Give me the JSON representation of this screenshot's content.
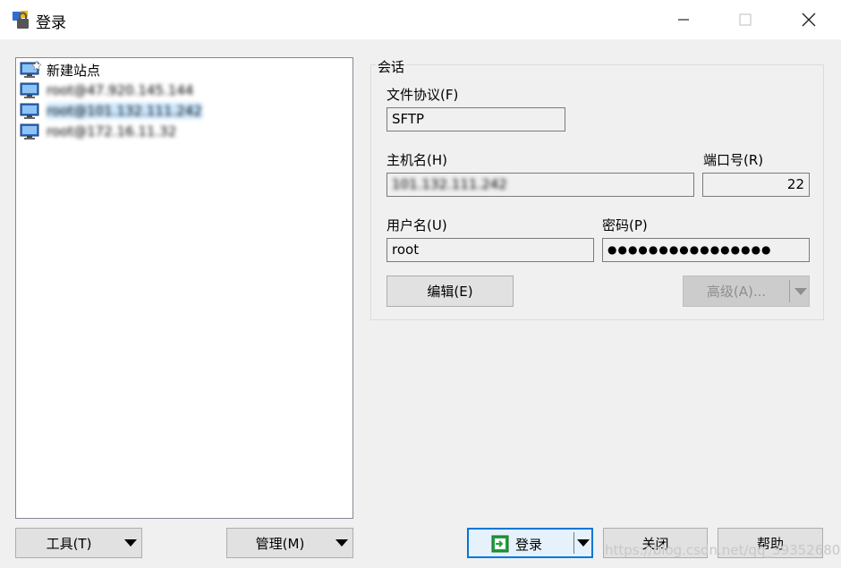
{
  "window": {
    "title": "登录"
  },
  "sites": {
    "items": [
      {
        "label": "新建站点",
        "icon": "new-site-icon"
      },
      {
        "label": "root@47.920.145.144",
        "icon": "monitor-icon"
      },
      {
        "label": "root@101.132.111.242",
        "icon": "monitor-icon"
      },
      {
        "label": "root@172.16.11.32",
        "icon": "monitor-icon"
      }
    ]
  },
  "session": {
    "group_label": "会话",
    "protocol_label": "文件协议(F)",
    "protocol_value": "SFTP",
    "host_label": "主机名(H)",
    "host_value": "101.132.111.242",
    "port_label": "端口号(R)",
    "port_value": "22",
    "user_label": "用户名(U)",
    "user_value": "root",
    "password_label": "密码(P)",
    "password_value": "●●●●●●●●●●●●●●●●",
    "edit_label": "编辑(E)",
    "advanced_label": "高级(A)..."
  },
  "bottom": {
    "tools_label": "工具(T)",
    "manage_label": "管理(M)",
    "login_label": "登录",
    "close_label": "关闭",
    "help_label": "帮助"
  },
  "watermark": "https://blog.csdn.net/qq_39352680",
  "colors": {
    "accent": "#0078d7",
    "selection": "#cce8ff"
  }
}
